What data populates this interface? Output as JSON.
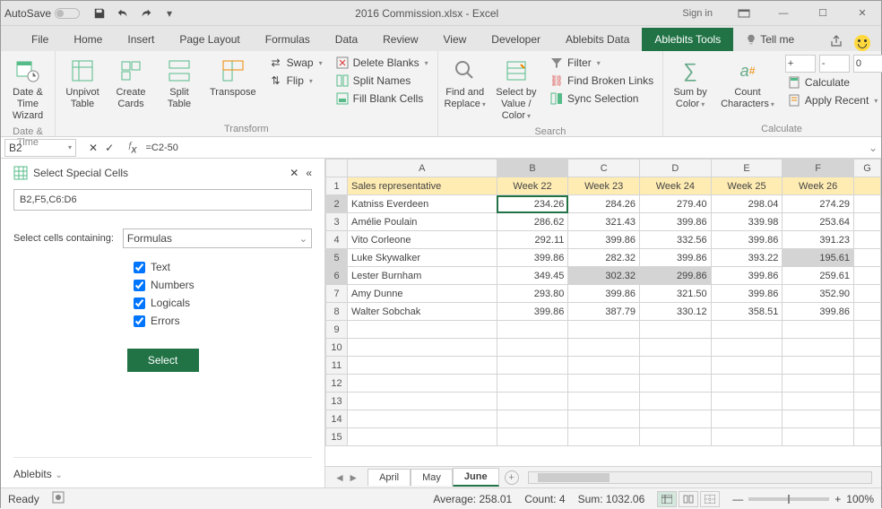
{
  "titlebar": {
    "autosave": "AutoSave",
    "doc": "2016 Commission.xlsx  -  Excel",
    "signin": "Sign in"
  },
  "tabs": [
    "File",
    "Home",
    "Insert",
    "Page Layout",
    "Formulas",
    "Data",
    "Review",
    "View",
    "Developer",
    "Ablebits Data",
    "Ablebits Tools"
  ],
  "tellme": "Tell me",
  "ribbon": {
    "g1": {
      "label": "Date & Time",
      "btn": "Date &\nTime Wizard"
    },
    "g2": {
      "label": "Transform",
      "b1": "Unpivot\nTable",
      "b2": "Create\nCards",
      "b3": "Split\nTable",
      "b4": "Transpose",
      "s1": "Swap",
      "s2": "Flip",
      "s3": "Delete Blanks",
      "s4": "Split Names",
      "s5": "Fill Blank Cells"
    },
    "g3": {
      "label": "Search",
      "b1": "Find and\nReplace",
      "b2": "Select by\nValue / Color",
      "s1": "Filter",
      "s2": "Find Broken Links",
      "s3": "Sync Selection"
    },
    "g4": {
      "label": "Calculate",
      "b1": "Sum by\nColor",
      "b2": "Count\nCharacters",
      "p": "+",
      "m": "-",
      "z": "0",
      "s1": "Calculate",
      "s2": "Apply Recent"
    }
  },
  "fx": {
    "cell": "B2",
    "formula": "=C2-50"
  },
  "panel": {
    "title": "Select Special Cells",
    "range": "B2,F5,C6:D6",
    "containLabel": "Select cells containing:",
    "containValue": "Formulas",
    "chk": [
      "Text",
      "Numbers",
      "Logicals",
      "Errors"
    ],
    "action": "Select",
    "foot": "Ablebits"
  },
  "cols": [
    "A",
    "B",
    "C",
    "D",
    "E",
    "F",
    "G"
  ],
  "header": [
    "Sales representative",
    "Week 22",
    "Week 23",
    "Week 24",
    "Week 25",
    "Week 26"
  ],
  "rows": [
    {
      "n": "Katniss Everdeen",
      "v": [
        "234.26",
        "284.26",
        "279.40",
        "298.04",
        "274.29"
      ]
    },
    {
      "n": "Amélie Poulain",
      "v": [
        "286.62",
        "321.43",
        "399.86",
        "339.98",
        "253.64"
      ]
    },
    {
      "n": "Vito Corleone",
      "v": [
        "292.11",
        "399.86",
        "332.56",
        "399.86",
        "391.23"
      ]
    },
    {
      "n": "Luke Skywalker",
      "v": [
        "399.86",
        "282.32",
        "399.86",
        "393.22",
        "195.61"
      ]
    },
    {
      "n": "Lester Burnham",
      "v": [
        "349.45",
        "302.32",
        "299.86",
        "399.86",
        "259.61"
      ]
    },
    {
      "n": "Amy Dunne",
      "v": [
        "293.80",
        "399.86",
        "321.50",
        "399.86",
        "352.90"
      ]
    },
    {
      "n": "Walter Sobchak",
      "v": [
        "399.86",
        "387.79",
        "330.12",
        "358.51",
        "399.86"
      ]
    }
  ],
  "sheets": [
    "April",
    "May",
    "June"
  ],
  "status": {
    "ready": "Ready",
    "avg": "Average: 258.01",
    "count": "Count: 4",
    "sum": "Sum: 1032.06",
    "zoom": "100%"
  }
}
